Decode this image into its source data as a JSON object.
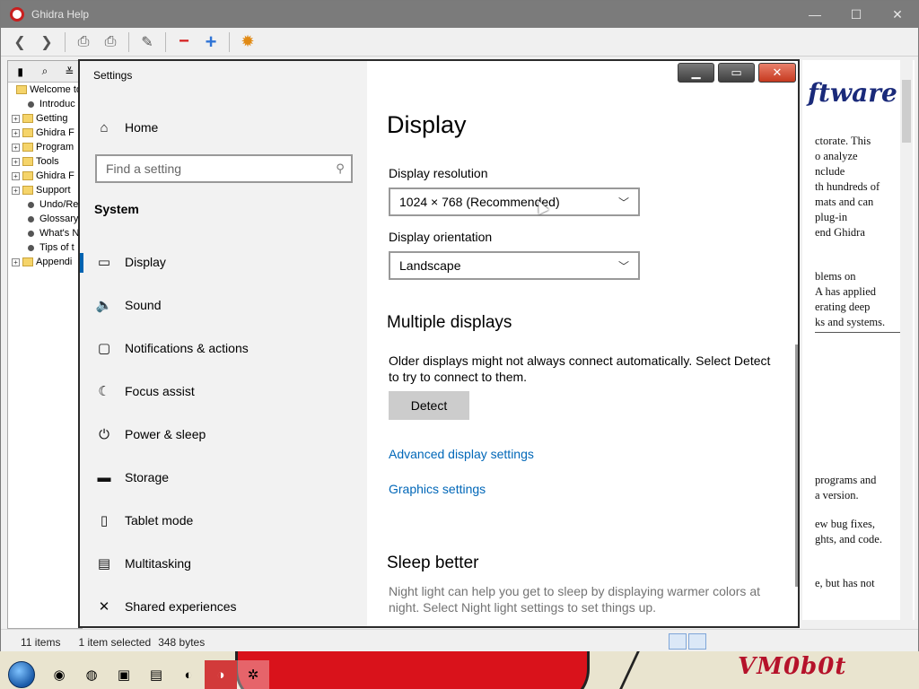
{
  "help_window": {
    "title": "Ghidra Help",
    "nav_items": [
      {
        "label": "Welcome to",
        "kind": "folder-open"
      },
      {
        "label": "Introduc",
        "kind": "leaf"
      },
      {
        "label": "Getting",
        "kind": "folder"
      },
      {
        "label": "Ghidra F",
        "kind": "folder"
      },
      {
        "label": "Program",
        "kind": "folder"
      },
      {
        "label": "Tools",
        "kind": "folder"
      },
      {
        "label": "Ghidra F",
        "kind": "folder"
      },
      {
        "label": "Support",
        "kind": "folder"
      },
      {
        "label": "Undo/Re",
        "kind": "leaf"
      },
      {
        "label": "Glossary",
        "kind": "leaf"
      },
      {
        "label": "What's N",
        "kind": "leaf"
      },
      {
        "label": "Tips of t",
        "kind": "leaf"
      },
      {
        "label": "Appendi",
        "kind": "folder"
      }
    ],
    "content": {
      "brand": "ftware",
      "lines1": [
        "ctorate. This",
        "o analyze",
        "nclude",
        "th hundreds of",
        "mats and can",
        "plug-in",
        "end Ghidra"
      ],
      "lines2": [
        "blems on",
        "A has applied",
        "erating deep",
        "ks and systems."
      ],
      "lines3": [
        "programs and",
        "a version."
      ],
      "lines4": [
        "ew bug fixes,",
        "ghts, and code."
      ],
      "lines5": [
        "e, but has not"
      ]
    },
    "status": {
      "items": "11 items",
      "selected": "1 item selected",
      "size": "348 bytes"
    }
  },
  "settings": {
    "window_title": "Settings",
    "home_label": "Home",
    "search_placeholder": "Find a setting",
    "section_label": "System",
    "nav": [
      {
        "label": "Display",
        "icon": "monitor-icon",
        "glyph": "▭"
      },
      {
        "label": "Sound",
        "icon": "speaker-icon",
        "glyph": "🔈"
      },
      {
        "label": "Notifications & actions",
        "icon": "notification-icon",
        "glyph": "▢"
      },
      {
        "label": "Focus assist",
        "icon": "moon-icon",
        "glyph": "☾"
      },
      {
        "label": "Power & sleep",
        "icon": "power-icon",
        "glyph": "⏻"
      },
      {
        "label": "Storage",
        "icon": "storage-icon",
        "glyph": "▬"
      },
      {
        "label": "Tablet mode",
        "icon": "tablet-icon",
        "glyph": "▯"
      },
      {
        "label": "Multitasking",
        "icon": "multitasking-icon",
        "glyph": "▤"
      },
      {
        "label": "Shared experiences",
        "icon": "shared-icon",
        "glyph": "✕"
      }
    ],
    "page_title": "Display",
    "resolution_label": "Display resolution",
    "resolution_value": "1024 × 768 (Recommended)",
    "orientation_label": "Display orientation",
    "orientation_value": "Landscape",
    "multiple_heading": "Multiple displays",
    "multiple_text": "Older displays might not always connect automatically. Select Detect to try to connect to them.",
    "detect_label": "Detect",
    "advanced_link": "Advanced display settings",
    "graphics_link": "Graphics settings",
    "sleep_heading": "Sleep better",
    "sleep_text": "Night light can help you get to sleep by displaying warmer colors at night. Select Night light settings to set things up."
  },
  "desktop": {
    "logo_text": "VM0b0t"
  },
  "colors": {
    "accent": "#0063b1",
    "link": "#0067b8"
  }
}
